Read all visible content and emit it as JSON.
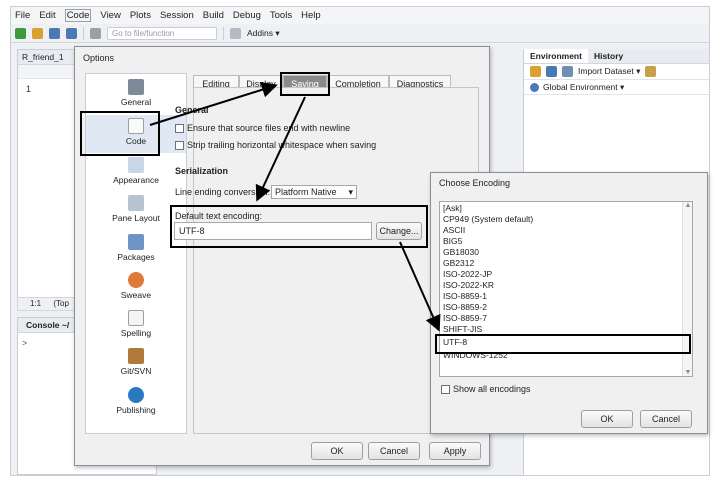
{
  "menubar": [
    "File",
    "Edit",
    "Code",
    "View",
    "Plots",
    "Session",
    "Build",
    "Debug",
    "Tools",
    "Help"
  ],
  "toolbar": {
    "goto_placeholder": "Go to file/function",
    "addins": "Addins ▾"
  },
  "editor": {
    "tab": "R_friend_1",
    "line": "1",
    "status_pos": "1:1",
    "status_scope": "(Top"
  },
  "console": {
    "tab": "Console ~/",
    "prompt": ">"
  },
  "right_pane": {
    "tabs": [
      "Environment",
      "History"
    ],
    "import": "Import Dataset ▾",
    "env": "Global Environment ▾"
  },
  "options": {
    "title": "Options",
    "categories": [
      "General",
      "Code",
      "Appearance",
      "Pane Layout",
      "Packages",
      "Sweave",
      "Spelling",
      "Git/SVN",
      "Publishing"
    ],
    "tabs": [
      "Editing",
      "Display",
      "Saving",
      "Completion",
      "Diagnostics"
    ],
    "general_heading": "General",
    "check1": "Ensure that source files end with newline",
    "check2": "Strip trailing horizontal whitespace when saving",
    "serialization_heading": "Serialization",
    "line_ending_label": "Line ending conversion:",
    "line_ending_value": "Platform Native",
    "encoding_label": "Default text encoding:",
    "encoding_value": "UTF-8",
    "change_button": "Change...",
    "ok": "OK",
    "cancel": "Cancel",
    "apply": "Apply"
  },
  "encoding_dialog": {
    "title": "Choose Encoding",
    "items": [
      "[Ask]",
      "CP949 (System default)",
      "ASCII",
      "BIG5",
      "GB18030",
      "GB2312",
      "ISO-2022-JP",
      "ISO-2022-KR",
      "ISO-8859-1",
      "ISO-8859-2",
      "ISO-8859-7",
      "SHIFT-JIS",
      "UTF-8",
      "WINDOWS-1252"
    ],
    "selected": "UTF-8",
    "show_all": "Show all encodings",
    "ok": "OK",
    "cancel": "Cancel"
  }
}
